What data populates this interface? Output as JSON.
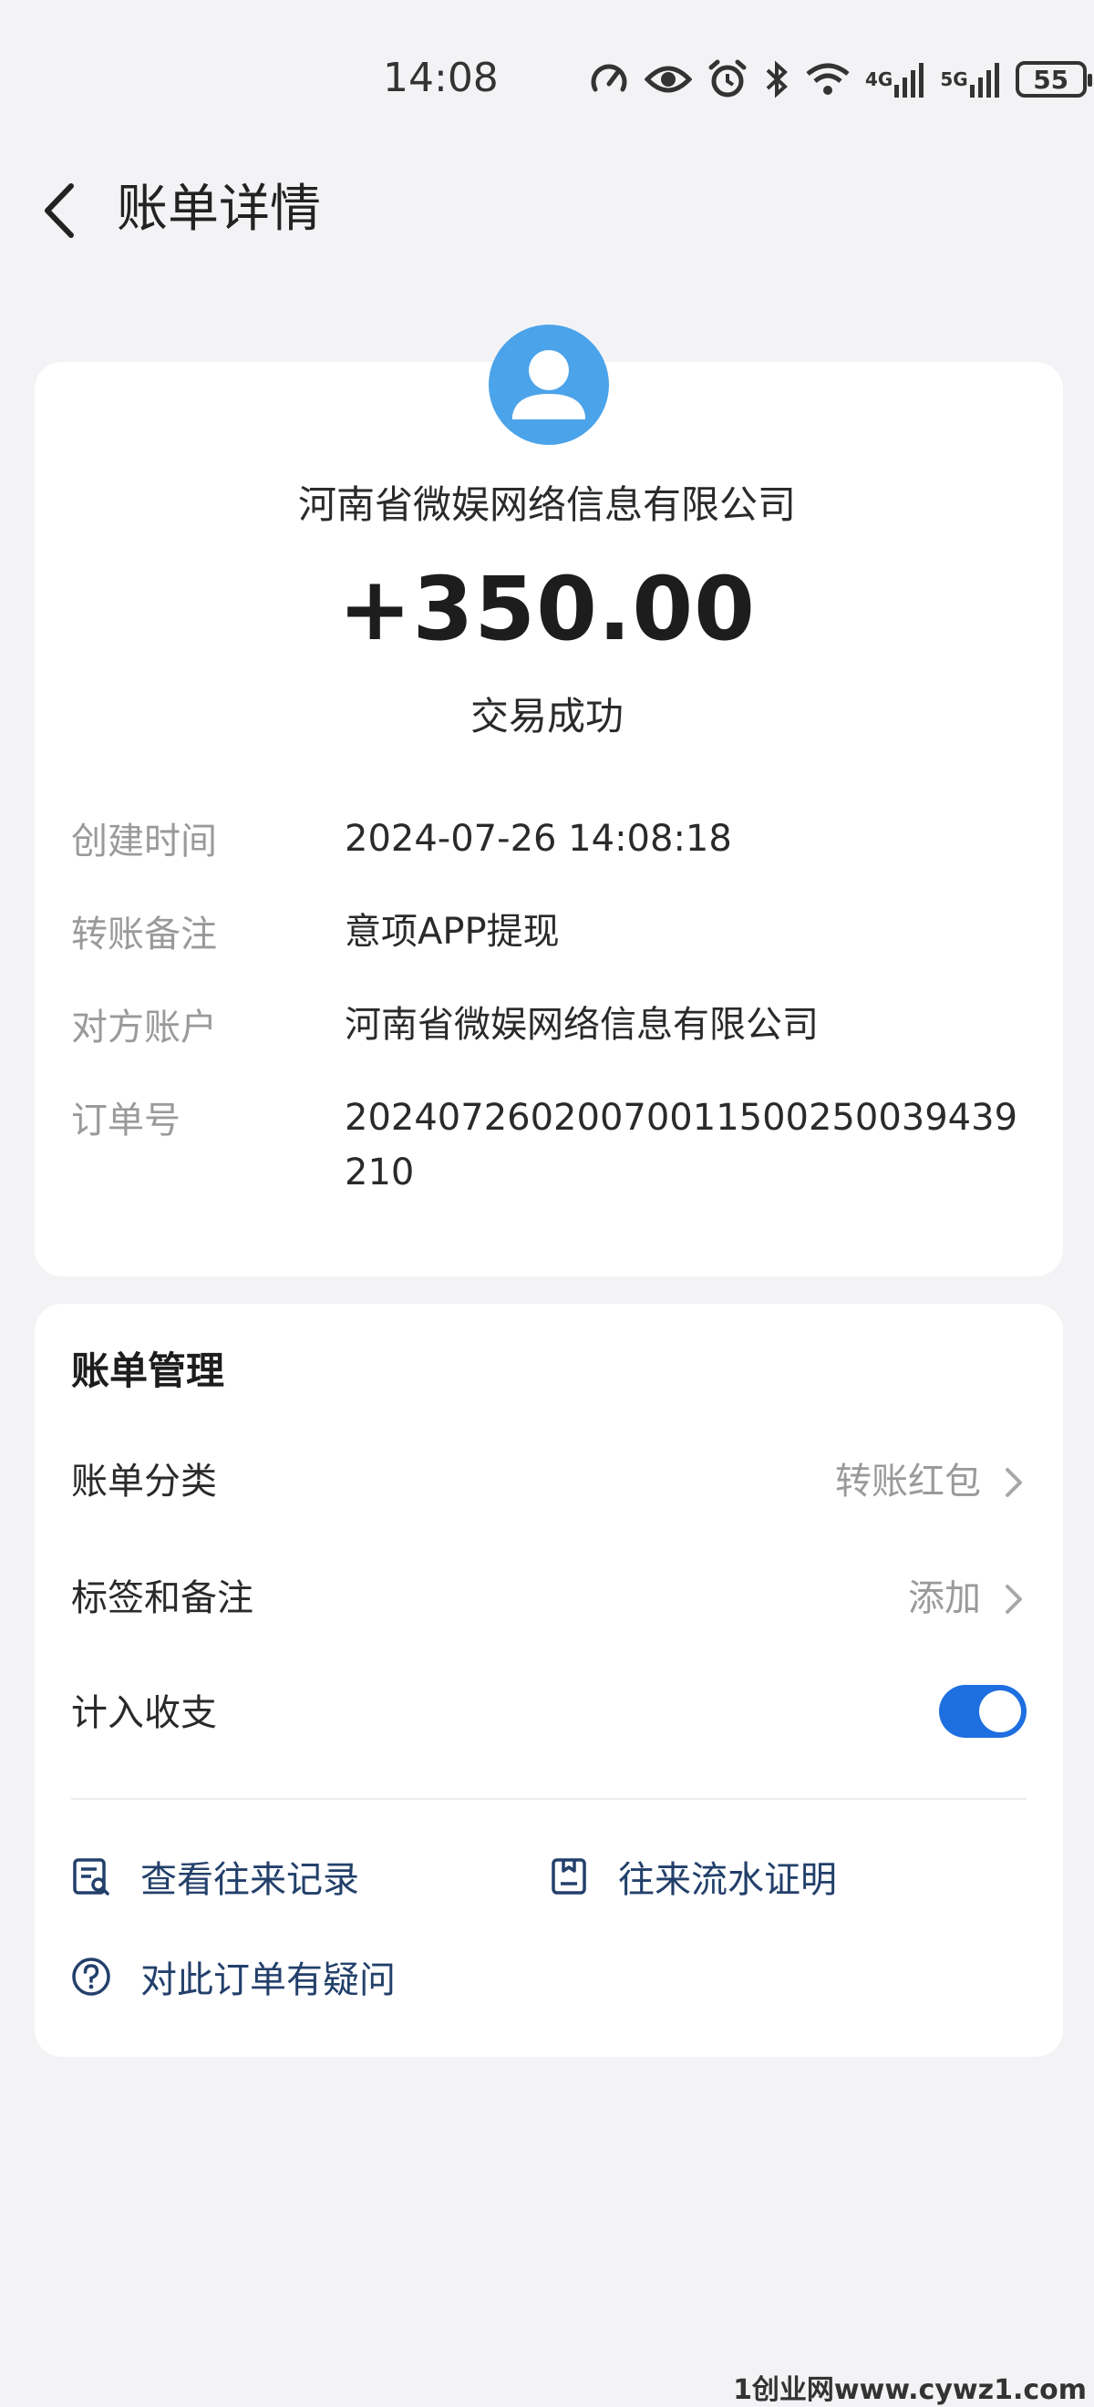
{
  "status_bar": {
    "time": "14:08",
    "net1": "4G",
    "net2": "5G",
    "battery": "55",
    "icons": [
      "speedometer-icon",
      "eye-icon",
      "alarm-icon",
      "bluetooth-icon",
      "wifi-icon",
      "signal-4g-icon",
      "signal-5g-icon",
      "battery-icon"
    ]
  },
  "header": {
    "title": "账单详情"
  },
  "summary": {
    "payee": "河南省微娱网络信息有限公司",
    "amount": "+350.00",
    "status": "交易成功",
    "avatar_color": "#4ba3ea"
  },
  "details": [
    {
      "label": "创建时间",
      "value": "2024-07-26 14:08:18"
    },
    {
      "label": "转账备注",
      "value": "意项APP提现"
    },
    {
      "label": "对方账户",
      "value": "河南省微娱网络信息有限公司"
    },
    {
      "label": "订单号",
      "value": "20240726020070011500250039439210"
    }
  ],
  "manage": {
    "title": "账单管理",
    "category_label": "账单分类",
    "category_value": "转账红包",
    "tags_label": "标签和备注",
    "tags_value": "添加",
    "include_label": "计入收支",
    "include_on": true,
    "accent": "#1e6fe0"
  },
  "links": {
    "records": "查看往来记录",
    "proof": "往来流水证明",
    "question": "对此订单有疑问"
  },
  "watermark": "1创业网www.cywz1.com"
}
